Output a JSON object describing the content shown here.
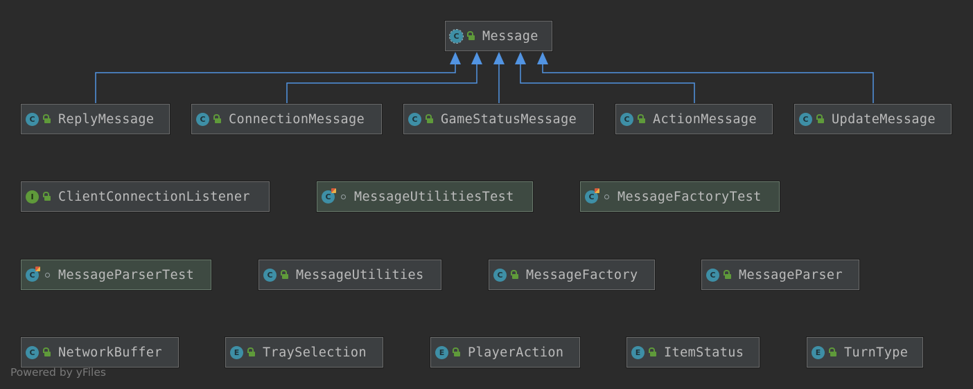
{
  "diagram": {
    "root": {
      "label": "Message",
      "kind": "abstract-class"
    },
    "subclasses": [
      {
        "label": "ReplyMessage",
        "kind": "class"
      },
      {
        "label": "ConnectionMessage",
        "kind": "class"
      },
      {
        "label": "GameStatusMessage",
        "kind": "class"
      },
      {
        "label": "ActionMessage",
        "kind": "class"
      },
      {
        "label": "UpdateMessage",
        "kind": "class"
      }
    ],
    "row2": [
      {
        "label": "ClientConnectionListener",
        "kind": "interface"
      },
      {
        "label": "MessageUtilitiesTest",
        "kind": "test-class"
      },
      {
        "label": "MessageFactoryTest",
        "kind": "test-class"
      }
    ],
    "row3": [
      {
        "label": "MessageParserTest",
        "kind": "test-class"
      },
      {
        "label": "MessageUtilities",
        "kind": "class"
      },
      {
        "label": "MessageFactory",
        "kind": "class"
      },
      {
        "label": "MessageParser",
        "kind": "class"
      }
    ],
    "row4": [
      {
        "label": "NetworkBuffer",
        "kind": "class"
      },
      {
        "label": "TraySelection",
        "kind": "enum"
      },
      {
        "label": "PlayerAction",
        "kind": "enum"
      },
      {
        "label": "ItemStatus",
        "kind": "enum"
      },
      {
        "label": "TurnType",
        "kind": "enum"
      }
    ],
    "edges": [
      {
        "from": "ReplyMessage",
        "to": "Message",
        "type": "extends"
      },
      {
        "from": "ConnectionMessage",
        "to": "Message",
        "type": "extends"
      },
      {
        "from": "GameStatusMessage",
        "to": "Message",
        "type": "extends"
      },
      {
        "from": "ActionMessage",
        "to": "Message",
        "type": "extends"
      },
      {
        "from": "UpdateMessage",
        "to": "Message",
        "type": "extends"
      }
    ],
    "colors": {
      "background": "#2b2b2b",
      "edge": "#5294e2",
      "node": "#3c3f41",
      "test_node": "#3e4a42"
    }
  },
  "icons": {
    "class": "C",
    "enum": "E",
    "interface": "I"
  },
  "watermark": "Powered by yFiles"
}
